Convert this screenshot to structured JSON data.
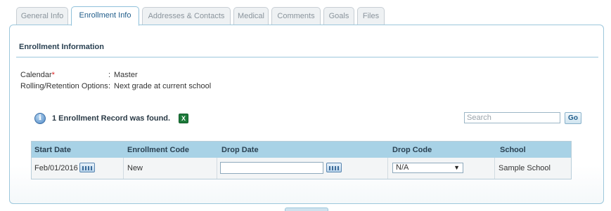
{
  "tabs": [
    {
      "label": "General Info",
      "active": false
    },
    {
      "label": "Enrollment Info",
      "active": true
    },
    {
      "label": "Addresses & Contacts",
      "active": false
    },
    {
      "label": "Medical",
      "active": false
    },
    {
      "label": "Comments",
      "active": false
    },
    {
      "label": "Goals",
      "active": false
    },
    {
      "label": "Files",
      "active": false
    }
  ],
  "section": {
    "title": "Enrollment Information",
    "fields": [
      {
        "label": "Calendar",
        "required_marker": "*",
        "separator": ":",
        "value": "Master"
      },
      {
        "label": "Rolling/Retention Options",
        "required_marker": "",
        "separator": ":",
        "value": "Next grade at current school"
      }
    ]
  },
  "records": {
    "info_icon": "info-icon",
    "found_text": "1 Enrollment Record was found.",
    "export_icon": "excel-export-icon",
    "search": {
      "placeholder": "Search",
      "value": ""
    },
    "go_label": "Go"
  },
  "table": {
    "columns": [
      "Start Date",
      "Enrollment Code",
      "Drop Date",
      "Drop Code",
      "School"
    ],
    "rows": [
      {
        "start_date": "Feb/01/2016",
        "enrollment_code": "New",
        "drop_date": "",
        "drop_code": "N/A",
        "school": "Sample School"
      }
    ]
  },
  "colors": {
    "accent": "#1f5c8a",
    "panel_border": "#9cc7dc",
    "table_header": "#a8d2e6",
    "required": "#dd2222"
  }
}
